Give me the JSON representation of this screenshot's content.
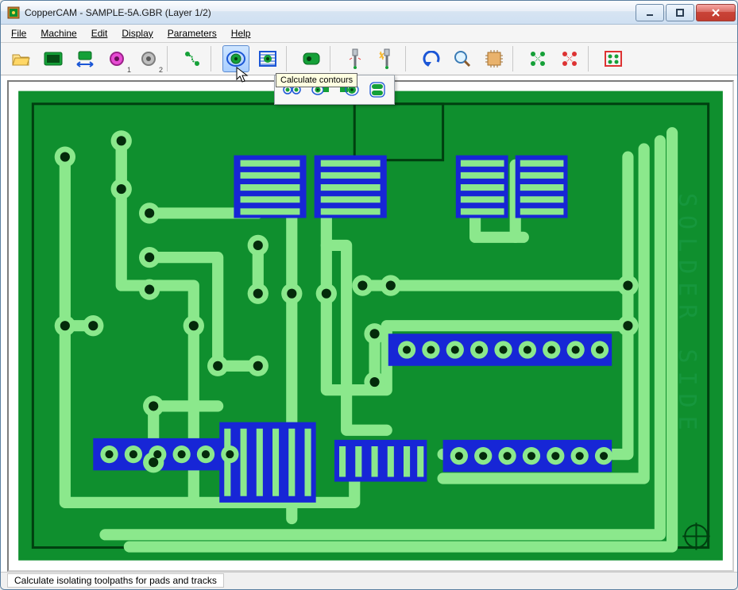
{
  "window": {
    "title": "CopperCAM  -  SAMPLE-5A.GBR  (Layer 1/2)"
  },
  "menus": {
    "file": "File",
    "machine": "Machine",
    "edit": "Edit",
    "display": "Display",
    "parameters": "Parameters",
    "help": "Help"
  },
  "tooltip": "Calculate contours",
  "status": "Calculate isolating toolpaths for pads and tracks",
  "pcb_text": "SOLDER SIDE",
  "colors": {
    "board": "#0f8f2e",
    "board_dark": "#005e16",
    "trace": "#8be88c",
    "pad": "#1726d6",
    "hole": "#071b07"
  }
}
